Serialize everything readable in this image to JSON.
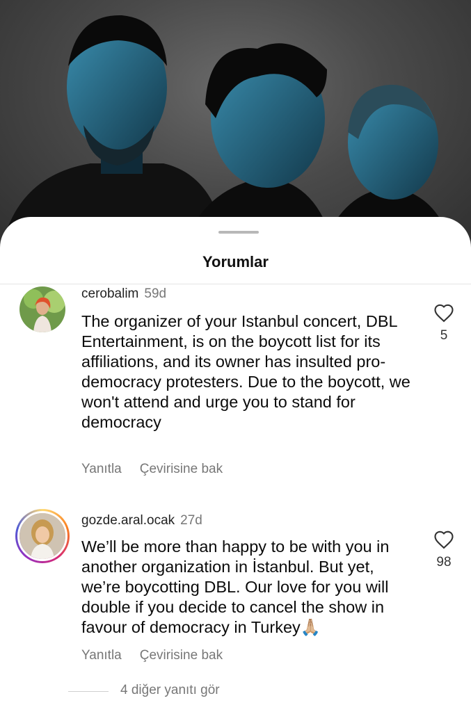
{
  "sheet": {
    "title": "Yorumlar"
  },
  "comments": [
    {
      "username": "cerobalim",
      "time": "59d",
      "text": "The organizer of your Istanbul concert, DBL Entertainment, is on the boycott list for its affiliations, and its owner has insulted pro-democracy protesters. Due to the boycott, we won't attend and urge you to stand for democracy",
      "likes": "5",
      "reply_label": "Yanıtla",
      "translate_label": "Çevirisine bak"
    },
    {
      "username": "gozde.aral.ocak",
      "time": "27d",
      "text": "We’ll be more than happy to be with you in another organization in İstanbul. But yet, we’re boycotting DBL. Our love for you will double if you decide to cancel the show in favour of democracy in Turkey🙏🏼",
      "likes": "98",
      "reply_label": "Yanıtla",
      "translate_label": "Çevirisine bak"
    }
  ],
  "more_replies": "4 diğer yanıtı gör",
  "icons": {
    "like": "heart-outline-icon"
  }
}
